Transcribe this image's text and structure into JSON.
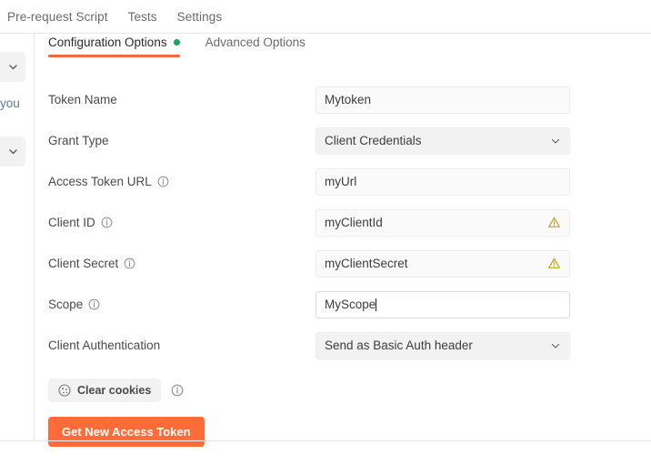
{
  "topnav": {
    "tabs": [
      {
        "label": "Pre-request Script"
      },
      {
        "label": "Tests"
      },
      {
        "label": "Settings"
      }
    ]
  },
  "left_strip": {
    "clipped_text": "you",
    "buttons": [
      {
        "icon": "chevron-down-icon"
      },
      {
        "icon": "chevron-down-icon"
      }
    ]
  },
  "subtabs": [
    {
      "label": "Configuration Options",
      "active": true,
      "status_dot": "#0fa958"
    },
    {
      "label": "Advanced Options",
      "active": false
    }
  ],
  "form": {
    "token_name": {
      "label": "Token Name",
      "value": "Mytoken",
      "has_info": false,
      "has_warning": false
    },
    "grant_type": {
      "label": "Grant Type",
      "value": "Client Credentials",
      "type": "select",
      "has_info": false
    },
    "access_token_url": {
      "label": "Access Token URL",
      "value": "myUrl",
      "has_info": true,
      "has_warning": false
    },
    "client_id": {
      "label": "Client ID",
      "value": "myClientId",
      "has_info": true,
      "has_warning": true
    },
    "client_secret": {
      "label": "Client Secret",
      "value": "myClientSecret",
      "has_info": true,
      "has_warning": true
    },
    "scope": {
      "label": "Scope",
      "value": "MyScope",
      "has_info": true,
      "focused": true
    },
    "client_authentication": {
      "label": "Client Authentication",
      "value": "Send as Basic Auth header",
      "type": "select",
      "has_info": false
    }
  },
  "actions": {
    "clear_cookies_label": "Clear cookies",
    "clear_cookies_icon": "cookie-icon",
    "get_token_label": "Get New Access Token"
  },
  "colors": {
    "accent_orange": "#ff6c37",
    "tab_underline": "#f2683c",
    "status_green": "#0fa958",
    "warning_amber": "#c8a020"
  }
}
